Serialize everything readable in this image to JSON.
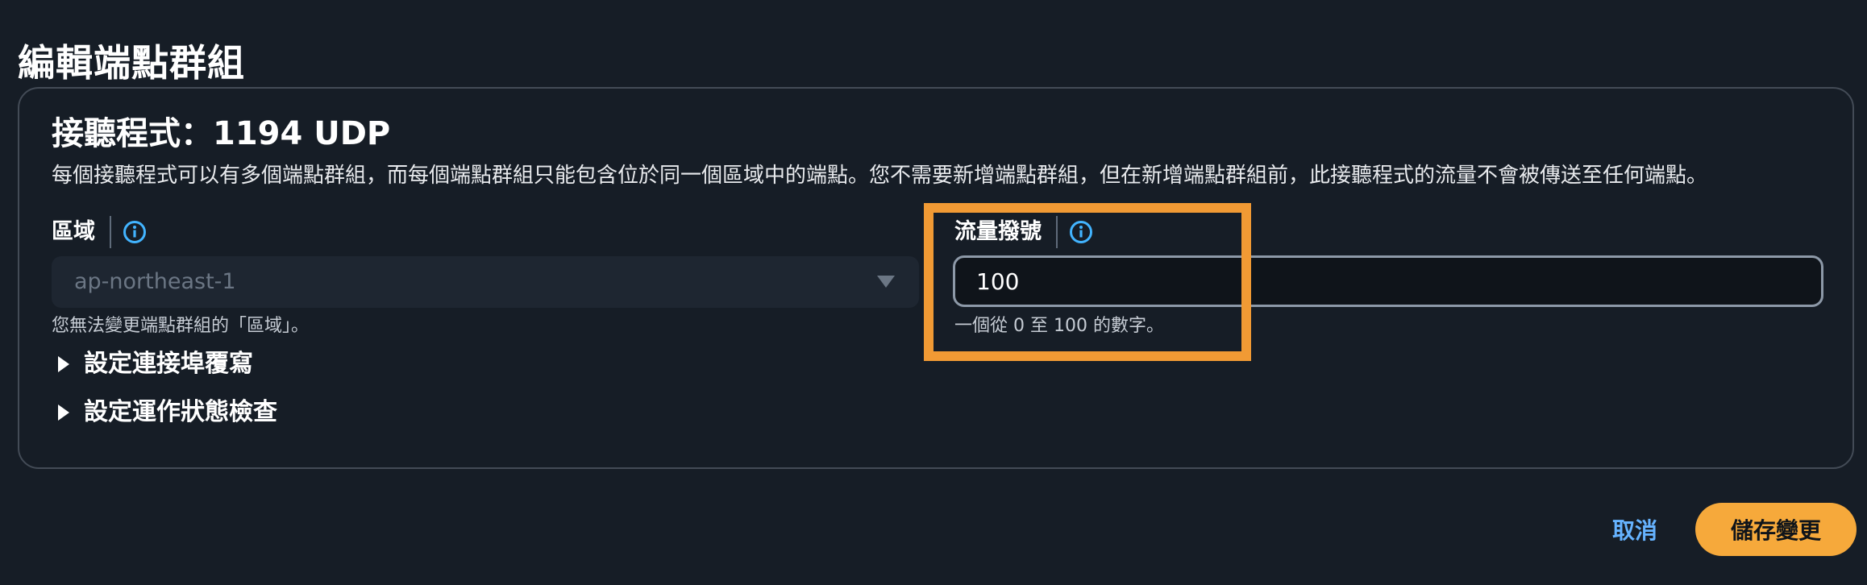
{
  "page": {
    "title": "編輯端點群組"
  },
  "listener": {
    "title": "接聽程式：1194 UDP",
    "description": "每個接聽程式可以有多個端點群組，而每個端點群組只能包含位於同一個區域中的端點。您不需要新增端點群組，但在新增端點群組前，此接聽程式的流量不會被傳送至任何端點。"
  },
  "region": {
    "label": "區域",
    "info_icon": "info-icon",
    "value": "ap-northeast-1",
    "hint": "您無法變更端點群組的「區域」。"
  },
  "traffic_dial": {
    "label": "流量撥號",
    "info_icon": "info-icon",
    "value": "100",
    "hint": "一個從 0 至 100 的數字。"
  },
  "expanders": {
    "port_override": "設定連接埠覆寫",
    "health_check": "設定運作狀態檢查"
  },
  "actions": {
    "cancel": "取消",
    "save": "儲存變更"
  },
  "colors": {
    "background": "#161d26",
    "highlight": "#f19a34",
    "primary_button": "#f6a93b",
    "link": "#66b3ff",
    "info_icon": "#42b4ff"
  }
}
